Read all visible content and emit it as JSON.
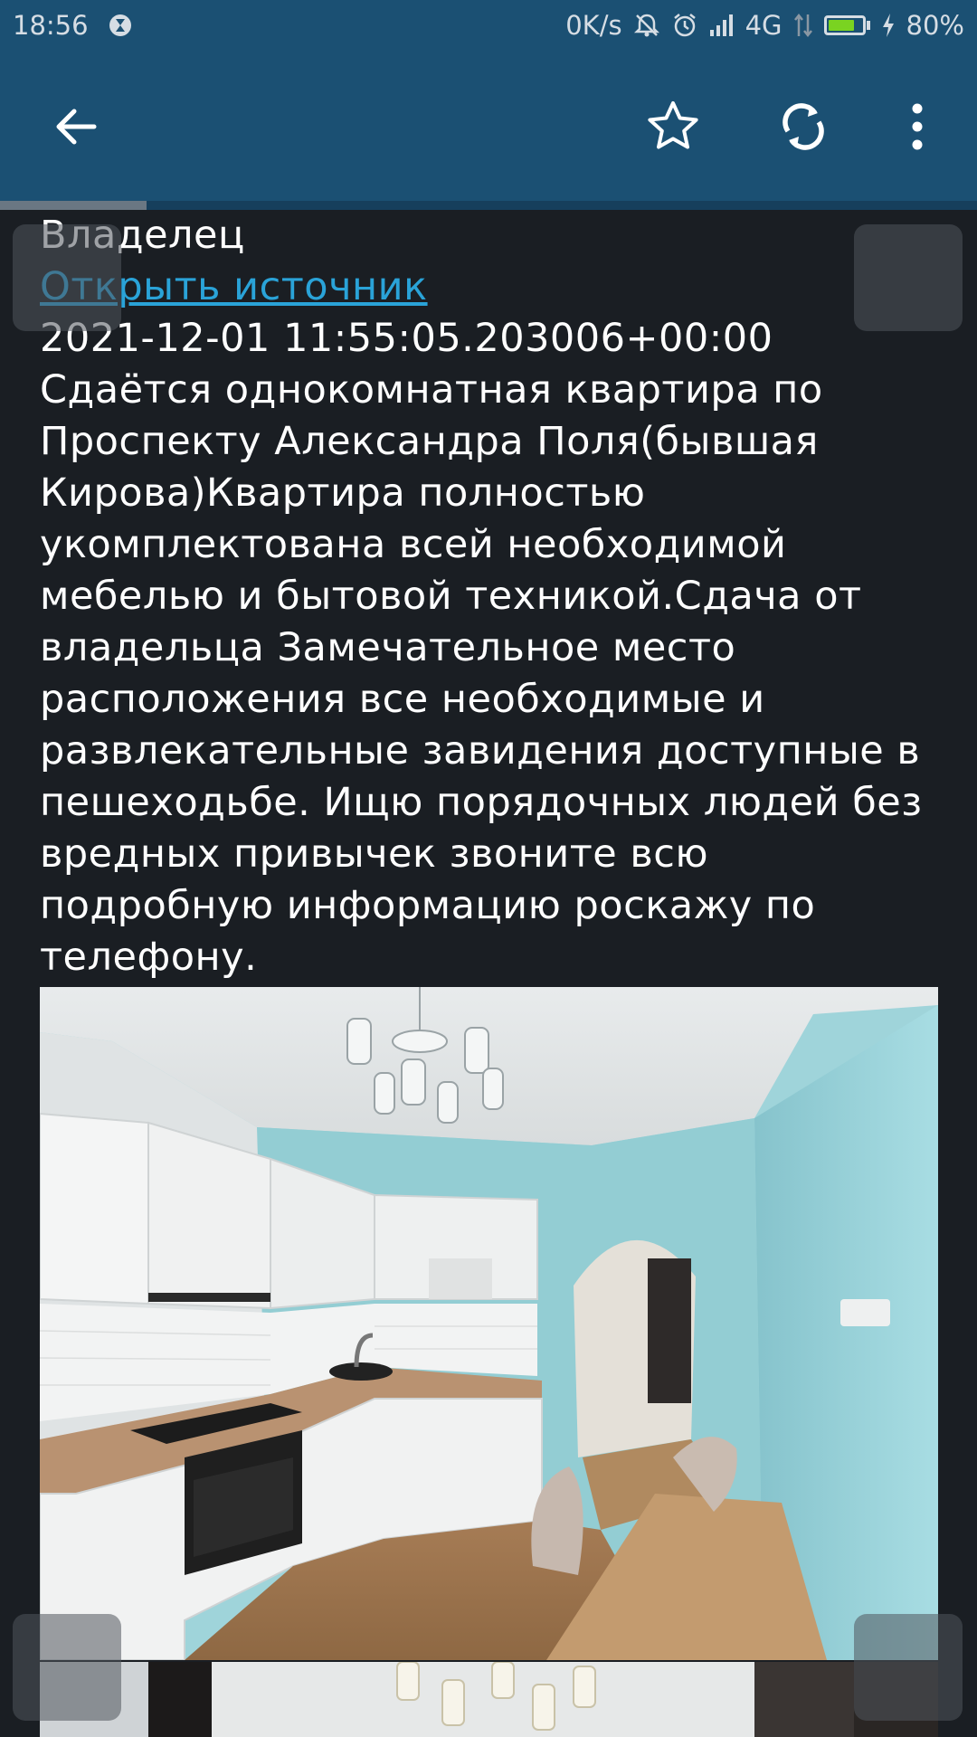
{
  "status_bar": {
    "time": "18:56",
    "net_speed": "0K/s",
    "network": "4G",
    "battery_percent": "80%",
    "battery_level": 0.8,
    "icons": [
      "hourglass-icon",
      "bell-off-icon",
      "alarm-icon",
      "signal-icon",
      "data-arrows-icon",
      "battery-icon",
      "charging-icon"
    ]
  },
  "app_bar": {
    "actions": [
      "back-arrow-icon",
      "star-icon",
      "refresh-icon",
      "more-vert-icon"
    ],
    "colors": {
      "background": "#1b5073",
      "icon": "#ffffff"
    }
  },
  "page_progress": 0.15,
  "listing": {
    "owner": "Владелец",
    "source_link": "Открыть источник",
    "timestamp": "2021-12-01 11:55:05.203006+00:00",
    "description": "Сдаётся однокомнатная квартира по Проспекту Александра Поля(бывшая Кирова)Квартира полностью укомплектована всей необходимой мебелью и бытовой техникой.Сдача от владельца Замечательное место расположения все необходимые и развлекательные завидения доступные в пешеходьбе. Ищю порядочных людей без вредных привычек звоните всю подробную информацию роскажу по телефону."
  },
  "colors": {
    "page_bg": "#1a1e23",
    "link": "#2aa3d8",
    "text": "#ffffff"
  }
}
